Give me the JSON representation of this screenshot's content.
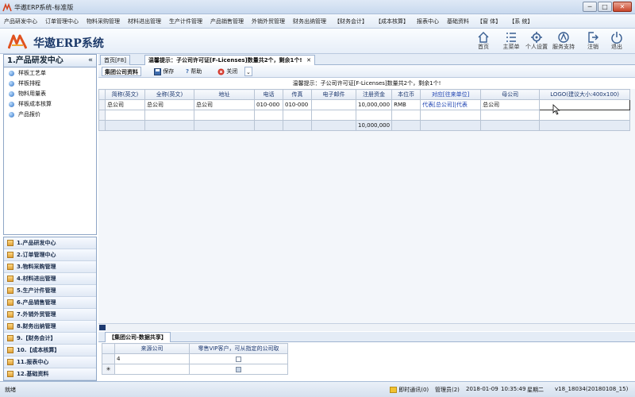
{
  "window": {
    "title": "华遨ERP系统-标准版",
    "min": "─",
    "max": "□",
    "close": "✕"
  },
  "menu": [
    "产品研发中心",
    "订单管理中心",
    "物料采购管理",
    "材料进出管理",
    "生产计件管理",
    "产品销售管理",
    "外销外贸管理",
    "财务出纳管理",
    "【财务会计】",
    "【成本核算】",
    "报表中心",
    "基础资料",
    "【窗 体】",
    "【系 统】"
  ],
  "brand": {
    "name": "华遨ERP系统"
  },
  "tools": [
    {
      "icon": "home-icon",
      "label": "首页"
    },
    {
      "icon": "menu-list-icon",
      "label": "主菜单"
    },
    {
      "icon": "gear-icon",
      "label": "个人设置"
    },
    {
      "icon": "support-icon",
      "label": "服务支持"
    },
    {
      "icon": "logout-icon",
      "label": "注销"
    },
    {
      "icon": "power-icon",
      "label": "退出"
    }
  ],
  "left": {
    "title": "1.产品研发中心",
    "collapse": "«",
    "tree": [
      "样板工艺单",
      "样板排程",
      "物料用量表",
      "样板成本核算",
      "产品报价"
    ],
    "modules": [
      "1.产品研发中心",
      "2.订单管理中心",
      "3.物料采购管理",
      "4.材料进出管理",
      "5.生产计件管理",
      "6.产品销售管理",
      "7.外销外贸管理",
      "8.财务出纳管理",
      "9.【财务会计】",
      "10.【成本核算】",
      "11.报表中心",
      "12.基础资料"
    ]
  },
  "tabs": [
    {
      "label": "首页[F8]"
    },
    {
      "label": "温馨提示：子公司许可证[F-Licenses]数量共2个，剩余1个!",
      "close": "✕"
    }
  ],
  "toolbar": {
    "title": "集团公司资料",
    "save": "保存",
    "help": "帮助",
    "close": "关闭",
    "more": "⌄"
  },
  "notice": "温馨提示：子公司许可证[F-Licenses]数量共2个，剩余1个!",
  "grid": {
    "headers": [
      "",
      "简称(英文)",
      "全称(英文)",
      "地址",
      "电话",
      "传真",
      "电子邮件",
      "注册资金",
      "本位币",
      "对应[往来单位]",
      "母公司",
      "LOGO(建议大小:400x100)"
    ],
    "rows": [
      [
        "",
        "总公司",
        "总公司",
        "总公司",
        "010-000",
        "010-000",
        "",
        "10,000,000",
        "RMB",
        "代表[总公司]|代表",
        "总公司",
        ""
      ],
      [
        "",
        "",
        "",
        "",
        "",
        "",
        "",
        "",
        "",
        "",
        "",
        ""
      ]
    ],
    "total": "10,000,000"
  },
  "subtab": {
    "label": "【集团公司-数据共享】"
  },
  "subgrid": {
    "headers": [
      "",
      "来源公司",
      "零售VIP客户，可从指定的公司取"
    ],
    "rows": [
      {
        "mark": "",
        "company": "4",
        "checked": false
      },
      {
        "mark": "✳",
        "company": "",
        "checked": false
      }
    ]
  },
  "status": {
    "left": "就绪",
    "chat": "即时通讯(0)",
    "user": "管理员(2)",
    "date": "2018-01-09",
    "time": "10:35:49",
    "weekday": "星期二",
    "version": "v18_18034(20180108_15)"
  },
  "colors": {
    "accent": "#1d3970",
    "link": "#1a3fb0",
    "selection": "#f2c230"
  }
}
